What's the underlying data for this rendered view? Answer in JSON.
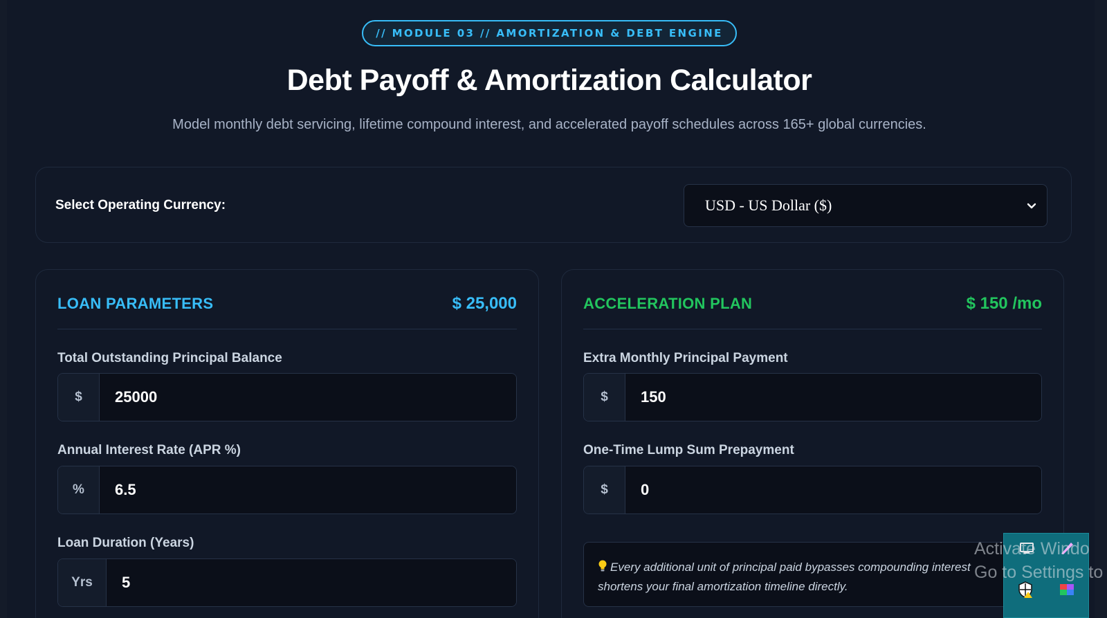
{
  "badge": "// MODULE 03 // AMORTIZATION & DEBT ENGINE",
  "title": "Debt Payoff & Amortization Calculator",
  "subtitle": "Model monthly debt servicing, lifetime compound interest, and accelerated payoff schedules across 165+ global currencies.",
  "currency": {
    "label": "Select Operating Currency:",
    "selected": "USD - US Dollar ($)"
  },
  "loan": {
    "title": "LOAN PARAMETERS",
    "amount": "$ 25,000",
    "principal": {
      "label": "Total Outstanding Principal Balance",
      "prefix": "$",
      "value": "25000"
    },
    "rate": {
      "label": "Annual Interest Rate (APR %)",
      "prefix": "%",
      "value": "6.5"
    },
    "duration": {
      "label": "Loan Duration (Years)",
      "prefix": "Yrs",
      "value": "5"
    }
  },
  "acceleration": {
    "title": "ACCELERATION PLAN",
    "amount": "$ 150 /mo",
    "extra": {
      "label": "Extra Monthly Principal Payment",
      "prefix": "$",
      "value": "150"
    },
    "lump": {
      "label": "One-Time Lump Sum Prepayment",
      "prefix": "$",
      "value": "0"
    },
    "tip_line1": "Every additional unit of principal paid bypasses compounding interest",
    "tip_line2": "shortens your final amortization timeline directly."
  },
  "watermark": {
    "line1": "Activate Windo",
    "line2": "Go to Settings to a"
  },
  "colors": {
    "accent_blue": "#38bdf8",
    "accent_green": "#22c55e",
    "background": "#111827"
  }
}
